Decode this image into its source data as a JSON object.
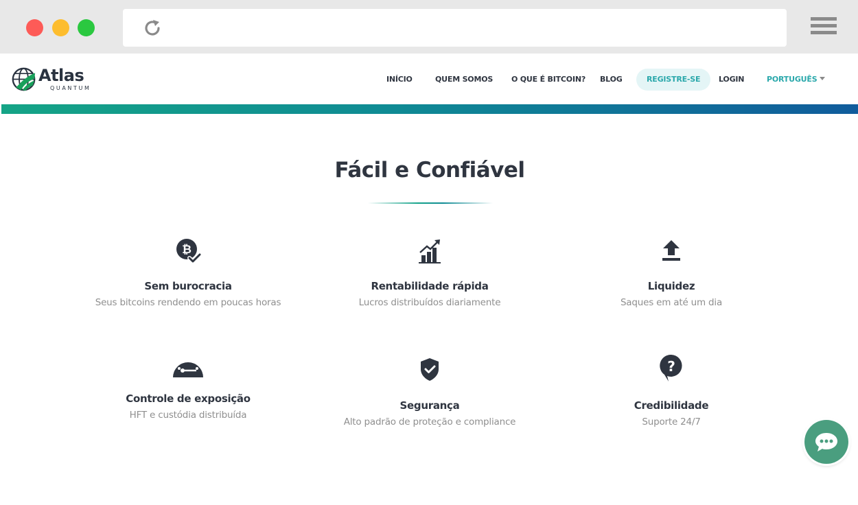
{
  "browser": {
    "reload_icon": "reload-icon",
    "menu_icon": "hamburger-icon",
    "window_buttons": [
      "close",
      "minimize",
      "maximize"
    ]
  },
  "site": {
    "logo": {
      "name": "Atlas",
      "sub": "QUANTUM",
      "icon": "globe-icon"
    },
    "nav": {
      "items": [
        "INÍCIO",
        "QUEM SOMOS",
        "O QUE É BITCOIN?",
        "BLOG",
        "REGISTRE-SE",
        "LOGIN",
        "PORTUGUÊS"
      ]
    },
    "colors": {
      "accent": "#2aa8ab",
      "gradient_start": "#15a486",
      "gradient_end": "#105c9c",
      "chat": "#4a9e7f",
      "text": "#2f3540",
      "muted": "#8f8f8f"
    }
  },
  "section": {
    "title": "Fácil e Confiável",
    "features": [
      {
        "icon": "bitcoin-check-icon",
        "title": "Sem burocracia",
        "desc": "Seus bitcoins rendendo em poucas horas"
      },
      {
        "icon": "growth-chart-icon",
        "title": "Rentabilidade rápida",
        "desc": "Lucros distribuídos diariamente"
      },
      {
        "icon": "upload-icon",
        "title": "Liquidez",
        "desc": "Saques em até um dia"
      },
      {
        "icon": "gauge-icon",
        "title": "Controle de exposição",
        "desc": "HFT e custódia distribuída"
      },
      {
        "icon": "shield-check-icon",
        "title": "Segurança",
        "desc": "Alto padrão de proteção e compliance"
      },
      {
        "icon": "question-bubble-icon",
        "title": "Credibilidade",
        "desc": "Suporte 24/7"
      }
    ]
  },
  "chat": {
    "icon": "chat-bubble-icon"
  }
}
